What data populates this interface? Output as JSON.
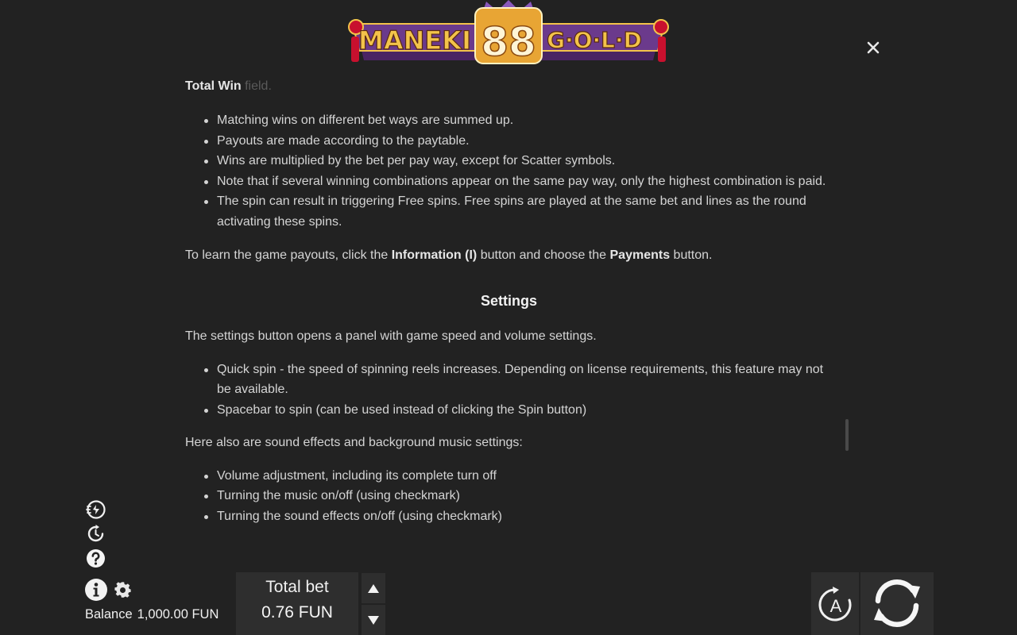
{
  "logo": {
    "word1": "MANEKI",
    "number": "88",
    "word2": "G·O·L·D"
  },
  "icons": {
    "close": "close-icon",
    "turbo": "turbo-spin-icon",
    "history": "history-icon",
    "help": "help-icon",
    "info": "info-icon",
    "settings": "gear-icon",
    "bet_up": "arrow-up-icon",
    "bet_down": "arrow-down-icon",
    "autoplay": "autoplay-icon",
    "spin": "spin-icon"
  },
  "content": {
    "faded_bold": "Total Win",
    "faded_rest": " field.",
    "wins_list": [
      "Matching wins on different bet ways are summed up.",
      "Payouts are made according to the paytable.",
      "Wins are multiplied by the bet per pay way, except for Scatter symbols.",
      "Note that if several winning combinations appear on the same pay way, only the highest combination is paid.",
      "The spin can result in triggering Free spins. Free spins are played at the same bet and lines as the round activating these spins."
    ],
    "payouts_pre": "To learn the game payouts, click the ",
    "payouts_b1": "Information (I)",
    "payouts_mid": " button and choose the ",
    "payouts_b2": "Payments",
    "payouts_post": " button.",
    "settings_title": "Settings",
    "settings_intro": "The settings button opens a panel with game speed and volume settings.",
    "settings_list": [
      "Quick spin - the speed of spinning reels increases. Depending on license requirements, this feature may not be available.",
      "Spacebar to spin (can be used instead of clicking the Spin button)"
    ],
    "sound_intro": "Here also are sound effects and background music settings:",
    "sound_list": [
      "Volume adjustment, including its complete turn off",
      "Turning the music on/off (using checkmark)",
      "Turning the sound effects on/off (using checkmark)"
    ]
  },
  "footer": {
    "balance_label": "Balance",
    "balance_value": "1,000.00 FUN",
    "bet_label": "Total bet",
    "bet_value": "0.76 FUN",
    "autoplay_letter": "A"
  },
  "colors": {
    "background": "#222222",
    "panel": "#2e2e2e",
    "text": "#d4d4d4",
    "logo_gold": "#f3c34a",
    "logo_purple": "#6b3a8c",
    "logo_red": "#c8102e"
  }
}
